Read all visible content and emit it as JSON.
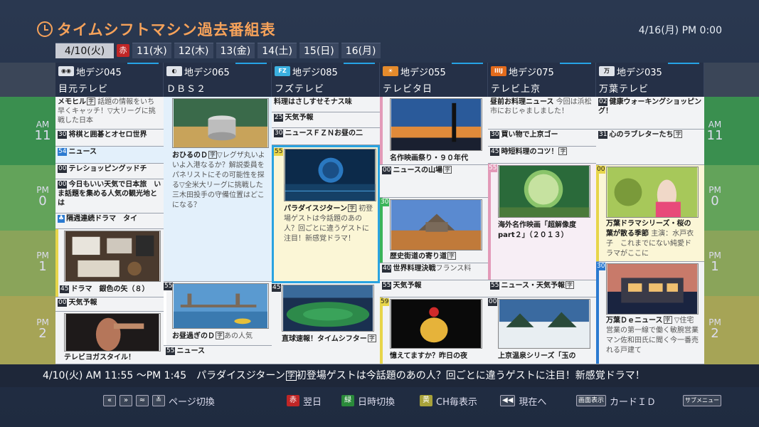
{
  "header": {
    "title": "タイムシフトマシン過去番組表",
    "datetime": "4/16(月) PM 0:00"
  },
  "tabs": [
    {
      "label": "4/10(火)"
    },
    {
      "label": "赤"
    },
    {
      "label": "11(水)"
    },
    {
      "label": "12(木)"
    },
    {
      "label": "13(金)"
    },
    {
      "label": "14(土)"
    },
    {
      "label": "15(日)"
    },
    {
      "label": "16(月)"
    }
  ],
  "timeaxis": [
    {
      "ampm": "AM",
      "hour": "11"
    },
    {
      "ampm": "PM",
      "hour": "0"
    },
    {
      "ampm": "PM",
      "hour": "1"
    },
    {
      "ampm": "PM",
      "hour": "2"
    }
  ],
  "channels": [
    {
      "number": "地デジ045",
      "name": "目元テレビ",
      "logo": "ch-logo"
    },
    {
      "number": "地デジ065",
      "name": "ＤＢＳ２",
      "logo": "ch-logo"
    },
    {
      "number": "地デジ085",
      "name": "フズテレビ",
      "logo": "ch-logo"
    },
    {
      "number": "地デジ055",
      "name": "テレビタ日",
      "logo": "ch-logo"
    },
    {
      "number": "地デジ075",
      "name": "テレビ上京",
      "logo": "ch-logo"
    },
    {
      "number": "地デジ035",
      "name": "万葉テレビ",
      "logo": "ch-logo"
    }
  ],
  "programs": {
    "c1": [
      {
        "min": "",
        "title": "メモヒル",
        "mark": "字",
        "desc": "話題の情報をいち早くキャッチ！▽大リーグに挑戦した日本"
      },
      {
        "min": "30",
        "title": "将棋と囲碁とオセロ世界",
        "mark": "",
        "desc": ""
      },
      {
        "min": "54",
        "title": "ニュース",
        "mark": "",
        "desc": ""
      },
      {
        "min": "00",
        "title": "テレショッピングッドチ",
        "mark": "",
        "desc": ""
      },
      {
        "min": "00",
        "title": "今日もいい天気で日本旅　いま話題を集める人気の観光地とは",
        "mark": "",
        "desc": ""
      },
      {
        "min": "",
        "title": "隔週連続ドラマ　タイ",
        "mark": "",
        "desc": ""
      },
      {
        "min": "45",
        "title": "ドラマ　銀色の矢（８）",
        "mark": "",
        "desc": ""
      },
      {
        "min": "00",
        "title": "天気予報",
        "mark": "",
        "desc": ""
      },
      {
        "min": "",
        "title": "テレビヨガスタイル！",
        "mark": "",
        "desc": ""
      }
    ],
    "c2": [
      {
        "min": "",
        "title": "おひるのＤ",
        "mark": "字",
        "desc": "▽レグザ丸いよいよ入港なるか？解説委員をパネリストにその可能性を探る▽全米大リーグに挑戦した三木田投手の守備位置はどこになる？"
      },
      {
        "min": "55",
        "title": "お昼過ぎのＤ",
        "mark": "字",
        "desc": "あの人気"
      },
      {
        "min": "55",
        "title": "ニュース",
        "mark": "",
        "desc": ""
      }
    ],
    "c3": [
      {
        "min": "",
        "title": "料理はさしすせそナス味",
        "mark": "",
        "desc": ""
      },
      {
        "min": "25",
        "title": "天気予報",
        "mark": "",
        "desc": ""
      },
      {
        "min": "30",
        "title": "ニュースＦＺＮお昼の二",
        "mark": "",
        "desc": ""
      },
      {
        "min": "55",
        "title": "パラダイスジターン",
        "mark": "字",
        "desc": "初登場ゲストは今話題のあの人？回ごとに違うゲストに注目！新感覚ドラマ！"
      },
      {
        "min": "45",
        "title": "直球速報！タイムシフター",
        "mark": "字",
        "desc": ""
      }
    ],
    "c4": [
      {
        "min": "",
        "title": "名作映画祭り・９０年代",
        "mark": "",
        "desc": ""
      },
      {
        "min": "00",
        "title": "ニュースの山場",
        "mark": "字",
        "desc": ""
      },
      {
        "min": "30",
        "title": "歴史街道の寄り道",
        "mark": "字",
        "desc": ""
      },
      {
        "min": "40",
        "title": "世界料理決戦",
        "mark": "",
        "desc": "フランス料"
      },
      {
        "min": "55",
        "title": "天気予報",
        "mark": "",
        "desc": ""
      },
      {
        "min": "59",
        "title": "憶えてますか？昨日の夜",
        "mark": "",
        "desc": ""
      }
    ],
    "c5": [
      {
        "min": "",
        "title": "昼前お料理ニュース",
        "mark": "",
        "desc": "今回は浜松市におじゃましました！"
      },
      {
        "min": "30",
        "title": "買い物で上京ゴー",
        "mark": "",
        "desc": ""
      },
      {
        "min": "45",
        "title": "時短料理のコツ！",
        "mark": "字",
        "desc": ""
      },
      {
        "min": "55",
        "title": "海外名作映画「超解像度part２」（２０１３）",
        "mark": "",
        "desc": ""
      },
      {
        "min": "55",
        "title": "ニュース・天気予報",
        "mark": "字",
        "desc": ""
      },
      {
        "min": "00",
        "title": "上京温泉シリーズ「玉の",
        "mark": "",
        "desc": ""
      }
    ],
    "c6": [
      {
        "min": "02",
        "title": "健康ウォーキングショッピング！",
        "mark": "",
        "desc": ""
      },
      {
        "min": "31",
        "title": "心のラブレターたち",
        "mark": "字",
        "desc": ""
      },
      {
        "min": "00",
        "title": "万葉ドラマシリーズ・桜の葉が散る季節",
        "mark": "",
        "desc": "主演：水戸衣子　これまでにない純愛ドラマがここに"
      },
      {
        "min": "30",
        "title": "万葉Ｄｅニュース",
        "mark": "字",
        "desc": "▽住宅営業の第一線で働く敏腕営業マン佐和田氏に聞く今一番売れる戸建て"
      }
    ]
  },
  "infobar": {
    "text": "4/10(火) AM 11:55 ～PM 1:45　パラダイスジターン",
    "mark": "字",
    "desc": "初登場ゲストは今話題のあの人？回ごとに違うゲストに注目！新感覚ドラマ！"
  },
  "footer": {
    "page_keys": [
      "«",
      "»",
      "≈",
      "≚"
    ],
    "page_label": "ページ切換",
    "red_key": "赤",
    "red_label": "翌日",
    "green_key": "緑",
    "green_label": "日時切換",
    "yellow_key": "黄",
    "yellow_label": "CH毎表示",
    "prev_key": "◀◀",
    "prev_label": "現在へ",
    "screen_key": "画面表示",
    "screen_label": "カードＩＤ",
    "submenu_key": "サブメニュー"
  }
}
